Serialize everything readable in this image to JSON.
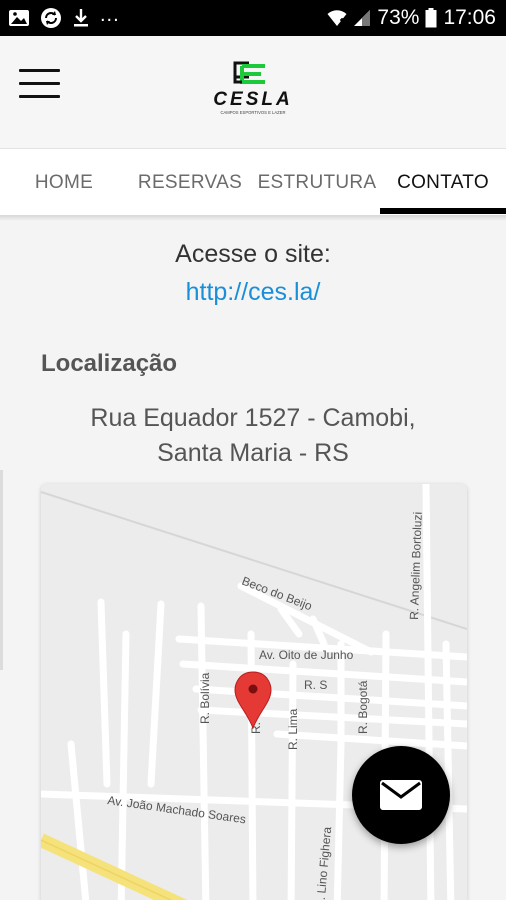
{
  "status_bar": {
    "ellipsis": "...",
    "battery": "73%",
    "time": "17:06",
    "icons": [
      "image-icon",
      "sync-icon",
      "download-icon",
      "wifi-icon",
      "signal-icon",
      "battery-icon"
    ]
  },
  "header": {
    "logo_text": "CESLA",
    "logo_tagline": "CAMPOS ESPORTIVOS E LAZER",
    "menu_icon": "hamburger-icon"
  },
  "tabs": [
    {
      "label": "HOME"
    },
    {
      "label": "RESERVAS"
    },
    {
      "label": "ESTRUTURA"
    },
    {
      "label": "CONTATO",
      "active": true
    }
  ],
  "contact": {
    "access_label": "Acesse o site:",
    "site_url": "http://ces.la/",
    "location_heading": "Localização",
    "address_line1": "Rua Equador 1527 - Camobi,",
    "address_line2": "Santa Maria - RS"
  },
  "map": {
    "streets": {
      "beco": "Beco do Beijo",
      "oito": "Av. Oito de Junho",
      "rs": "R. S",
      "bolivia": "R. Bolívia",
      "lima": "R. Lima",
      "bogota": "R. Bogotá",
      "bortoluzi": "R. Angelim Bortoluzi",
      "joao": "Av. João Machado Soares",
      "fighera": "R. Lino Fighera",
      "marker_street": "R."
    },
    "marker_icon": "map-pin-icon"
  },
  "fab": {
    "icon": "mail-icon"
  },
  "colors": {
    "link": "#1a8fd8",
    "marker": "#e53935",
    "fab": "#000000"
  }
}
